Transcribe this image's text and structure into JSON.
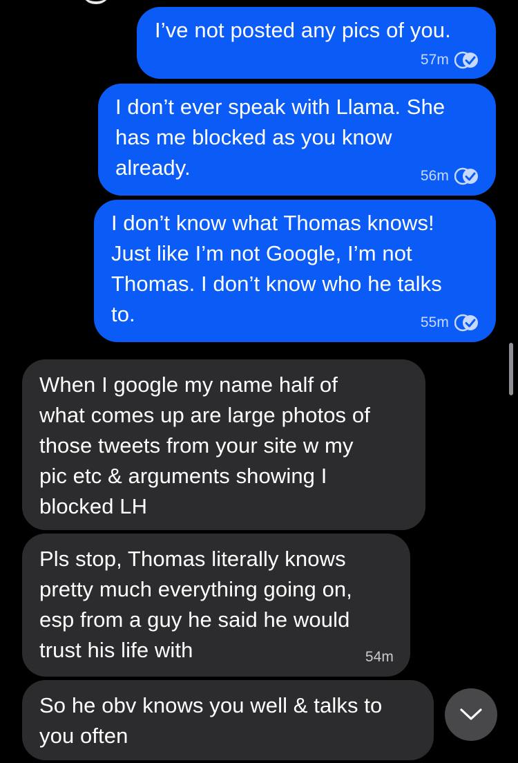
{
  "colors": {
    "background": "#000000",
    "outgoing_bubble": "#0b5cf7",
    "incoming_bubble": "#2c2c2e",
    "scroll_button": "#48484a"
  },
  "messages": [
    {
      "direction": "outgoing",
      "text": "I’ve not posted any pics of you.",
      "time": "57m",
      "status_icon": "double-check-icon"
    },
    {
      "direction": "outgoing",
      "text": "I don’t ever speak with Llama. She\nhas me blocked as you know\nalready.",
      "time": "56m",
      "status_icon": "double-check-icon"
    },
    {
      "direction": "outgoing",
      "text": "I don’t know what Thomas knows!\nJust like I’m not Google, I’m not\nThomas. I don’t know who he talks\nto.",
      "time": "55m",
      "status_icon": "double-check-icon"
    },
    {
      "direction": "incoming",
      "text": "When I google my name half of\nwhat comes up are large photos of\nthose tweets from your site w my\npic etc & arguments showing I\nblocked LH",
      "time": ""
    },
    {
      "direction": "incoming",
      "text": "Pls stop, Thomas literally knows\npretty much everything going on,\nesp from a guy he said he would\ntrust his life with",
      "time": "54m"
    },
    {
      "direction": "incoming",
      "text": "So he obv knows you well & talks to\nyou often",
      "time": ""
    }
  ],
  "controls": {
    "scroll_down_icon": "chevron-down-icon"
  }
}
